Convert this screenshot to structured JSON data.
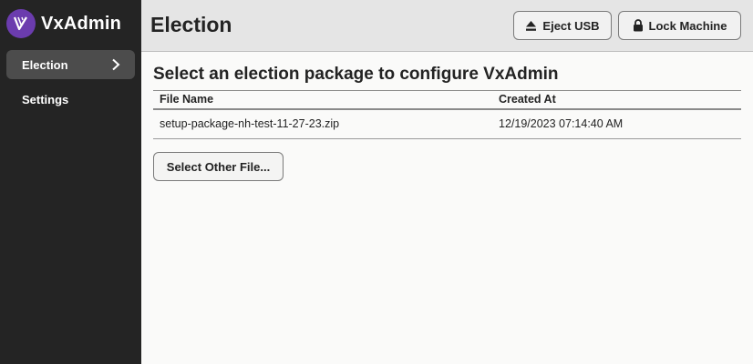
{
  "app": {
    "name": "VxAdmin",
    "logo_icon": "vx-logo-icon",
    "brand_color": "#6b3cae"
  },
  "sidebar": {
    "items": [
      {
        "label": "Election",
        "active": true,
        "icon": "chevron-right-icon"
      },
      {
        "label": "Settings",
        "active": false
      }
    ]
  },
  "header": {
    "title": "Election",
    "eject_label": "Eject USB",
    "eject_icon": "eject-icon",
    "lock_label": "Lock Machine",
    "lock_icon": "lock-icon"
  },
  "main": {
    "heading": "Select an election package to configure VxAdmin",
    "table": {
      "columns": [
        "File Name",
        "Created At"
      ],
      "rows": [
        {
          "file_name": "setup-package-nh-test-11-27-23.zip",
          "created_at": "12/19/2023 07:14:40 AM"
        }
      ]
    },
    "select_other_label": "Select Other File..."
  }
}
